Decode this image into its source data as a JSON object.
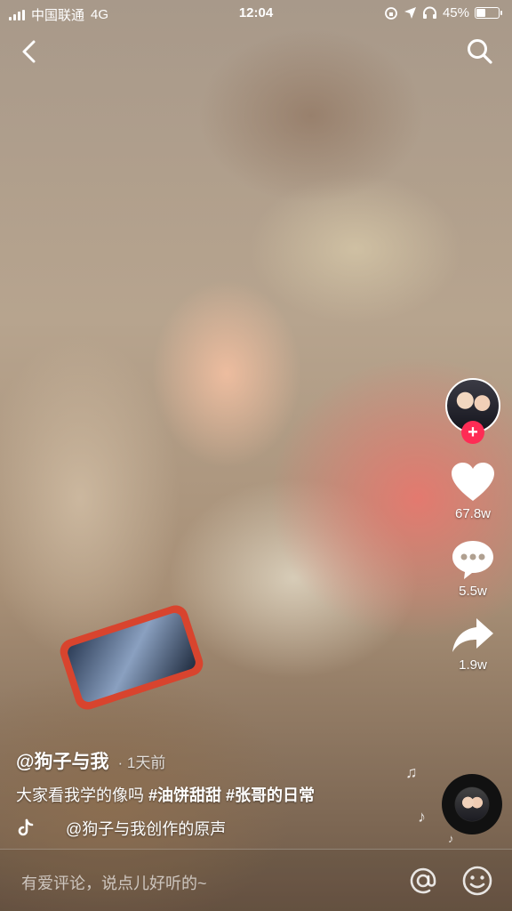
{
  "status_bar": {
    "carrier": "中国联通",
    "network": "4G",
    "time": "12:04",
    "battery": "45%",
    "battery_level": 0.45
  },
  "actions": {
    "likes": "67.8w",
    "comments": "5.5w",
    "shares": "1.9w"
  },
  "post": {
    "author": "@狗子与我",
    "time_ago": "· 1天前",
    "description": "大家看我学的像吗",
    "hashtags": [
      "#油饼甜甜",
      "#张哥的日常"
    ],
    "sound": "@狗子与我创作的原声"
  },
  "comment_bar": {
    "placeholder": "有爱评论，说点儿好听的~"
  },
  "colors": {
    "accent": "#fe2c55",
    "icon": "#ffffff"
  }
}
